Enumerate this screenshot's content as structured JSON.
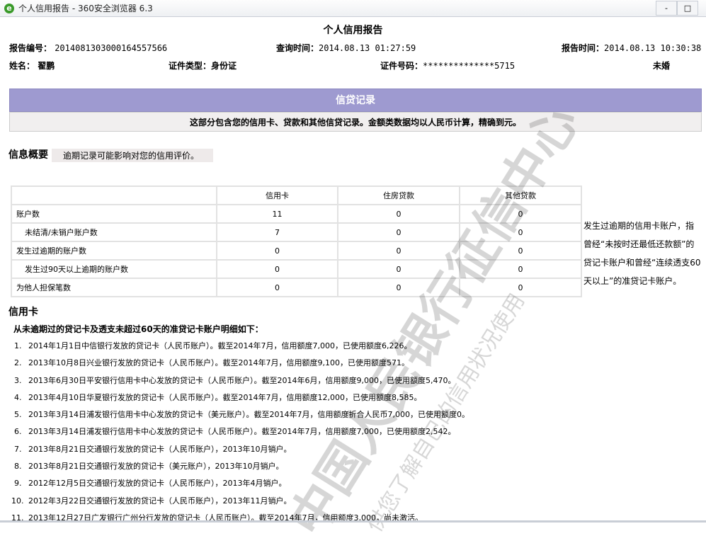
{
  "window": {
    "title": "个人信用报告 - 360安全浏览器 6.3",
    "minimize": "-",
    "maximize": "□"
  },
  "report": {
    "title": "个人信用报告",
    "report_no_label": "报告编号：",
    "report_no": "2014081303000164557566",
    "query_time_label": "查询时间：",
    "query_time": "2014.08.13 01:27:59",
    "report_time_label": "报告时间：",
    "report_time": "2014.08.13 10:30:38",
    "name_label": "姓名：",
    "name": "翟鹏",
    "id_type_label": "证件类型：",
    "id_type": "身份证",
    "id_no_label": "证件号码：",
    "id_no": "**************5715",
    "marital": "未婚"
  },
  "section": {
    "title": "信贷记录",
    "desc": "这部分包含您的信用卡、贷款和其他信贷记录。金额类数据均以人民币计算，精确到元。"
  },
  "overview": {
    "title": "信息概要",
    "note": "逾期记录可能影响对您的信用评价。",
    "headers": [
      "",
      "信用卡",
      "住房贷款",
      "其他贷款"
    ],
    "rows": [
      {
        "label": "账户数",
        "values": [
          "11",
          "0",
          "0"
        ]
      },
      {
        "label": "未结清/未销户账户数",
        "values": [
          "7",
          "0",
          "0"
        ]
      },
      {
        "label": "发生过逾期的账户数",
        "values": [
          "0",
          "0",
          "0"
        ]
      },
      {
        "label": "发生过90天以上逾期的账户数",
        "values": [
          "0",
          "0",
          "0"
        ]
      },
      {
        "label": "为他人担保笔数",
        "values": [
          "0",
          "0",
          "0"
        ]
      }
    ],
    "side_note": "发生过逾期的信用卡账户，指曾经“未按时还最低还款额”的贷记卡账户和曾经“连续透支60天以上”的准贷记卡账户。"
  },
  "credit_card": {
    "title": "信用卡",
    "list_title": "从未逾期过的贷记卡及透支未超过60天的准贷记卡账户明细如下：",
    "items": [
      "2014年1月1日中信银行发放的贷记卡（人民币账户）。截至2014年7月，信用额度7,000，已使用额度6,226。",
      "2013年10月8日兴业银行发放的贷记卡（人民币账户）。截至2014年7月，信用额度9,100，已使用额度571。",
      "2013年6月30日平安银行信用卡中心发放的贷记卡（人民币账户）。截至2014年6月，信用额度9,000，已使用额度5,470。",
      "2013年4月10日华夏银行发放的贷记卡（人民币账户）。截至2014年7月，信用额度12,000，已使用额度8,585。",
      "2013年3月14日浦发银行信用卡中心发放的贷记卡（美元账户）。截至2014年7月，信用额度折合人民币7,000，已使用额度0。",
      "2013年3月14日浦发银行信用卡中心发放的贷记卡（人民币账户）。截至2014年7月，信用额度7,000，已使用额度2,542。",
      "2013年8月21日交通银行发放的贷记卡（人民币账户），2013年10月销户。",
      "2013年8月21日交通银行发放的贷记卡（美元账户），2013年10月销户。",
      "2012年12月5日交通银行发放的贷记卡（人民币账户），2013年4月销户。",
      "2012年3月22日交通银行发放的贷记卡（人民币账户），2013年11月销户。",
      "2013年12月27日广发银行广州分行发放的贷记卡（人民币账户）。截至2014年7月，信用额度3,000，尚未激活。"
    ]
  },
  "watermark": {
    "main": "中国人民银行征信中心",
    "sub": "供您了解自己的信用状况使用"
  }
}
